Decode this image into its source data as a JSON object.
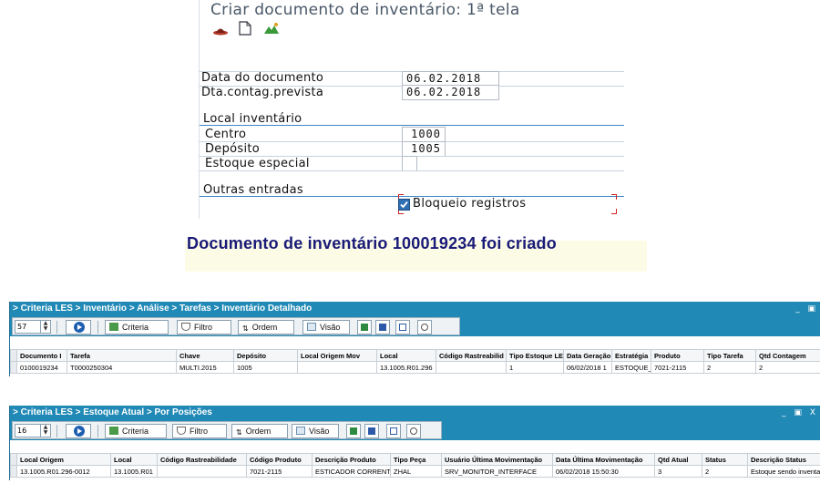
{
  "sap": {
    "title": "Criar documento de inventário: 1ª tela",
    "toolbar_icons": [
      "hat-icon",
      "new-document-icon",
      "mountain-icon"
    ],
    "fields": {
      "data_documento": {
        "label": "Data do documento",
        "value": "06.02.2018"
      },
      "dta_contag": {
        "label": "Dta.contag.prevista",
        "value": "06.02.2018"
      },
      "centro": {
        "label": "Centro",
        "value": "1000"
      },
      "deposito": {
        "label": "Depósito",
        "value": "1005"
      },
      "estoque_especial": {
        "label": "Estoque especial",
        "value": ""
      }
    },
    "section_local": "Local inventário",
    "section_outras": "Outras entradas",
    "bloqueio": {
      "label": "Bloqueio registros",
      "checked": true
    }
  },
  "message": {
    "text": "Documento de inventário 100019234 foi criado",
    "color": "#1a1a78"
  },
  "window1": {
    "title": "> Criteria LES > Inventário > Análise > Tarefas > Inventário Detalhado",
    "controls": "_ ▣",
    "spinner": "57",
    "buttons": {
      "criteria": "Criteria",
      "filtro": "Filtro",
      "ordem": "Ordem",
      "visao": "Visão"
    },
    "columns": [
      "Documento I",
      "Tarefa",
      "Chave",
      "Depósito",
      "Local Origem Mov",
      "Local",
      "Código Rastreabilid",
      "Tipo Estoque LE",
      "Data Geração",
      "Estratégia",
      "Produto",
      "Tipo Tarefa",
      "Qtd Contagem"
    ],
    "rows": [
      [
        "0100019234",
        "T0000250304",
        "MULTI.2015",
        "1005",
        "",
        "13.1005.R01.296",
        "",
        "1",
        "06/02/2018 1",
        "ESTOQUE_A",
        "7021-2115",
        "2",
        "2"
      ]
    ]
  },
  "window2": {
    "title": "> Criteria LES > Estoque Atual > Por Posições",
    "controls": "_ ▣ X",
    "spinner": "16",
    "buttons": {
      "criteria": "Criteria",
      "filtro": "Filtro",
      "ordem": "Ordem",
      "visao": "Visão"
    },
    "columns": [
      "Local Origem",
      "Local",
      "Código Rastreabilidade",
      "Código Produto",
      "Descrição Produto",
      "Tipo Peça",
      "Usuário Última Movimentação",
      "Data Última Movimentação",
      "Qtd Atual",
      "Status",
      "Descrição Status"
    ],
    "rows": [
      [
        "13.1005.R01.296-0012",
        "13.1005.R01",
        "",
        "7021-2115",
        "ESTICADOR CORRENT",
        "ZHAL",
        "SRV_MONITOR_INTERFACE",
        "06/02/2018 15:50:30",
        "3",
        "2",
        "Estoque sendo inventa"
      ]
    ]
  },
  "colors": {
    "title_bar": "#2189b5",
    "section_line": "#3a85c6",
    "message_bg": "#fbfbe6"
  }
}
